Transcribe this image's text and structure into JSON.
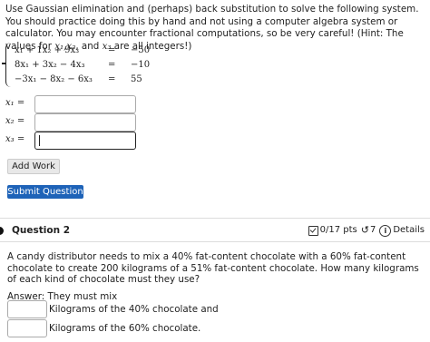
{
  "question1": {
    "instructions_part1": "Use Gaussian elimination and (perhaps) back substitution to solve the following system. You should practice doing this by hand and not using a computer algebra system or calculator. You may encounter fractional computations, so be very careful! (Hint: The values for ",
    "var_x1_x2": "x₁,x₂",
    "instructions_and": ", and ",
    "var_x3": "x₃",
    "instructions_part2": " are all integers!)",
    "equations": [
      {
        "lhs": "x₁ + 1x₂ + 9x₃",
        "rel": "=",
        "rhs": "−50"
      },
      {
        "lhs": "8x₁ + 3x₂ − 4x₃",
        "rel": "=",
        "rhs": "−10"
      },
      {
        "lhs": "−3x₁ − 8x₂ − 6x₃",
        "rel": "=",
        "rhs": "55"
      }
    ],
    "answers": [
      {
        "label": "x₁ =",
        "value": ""
      },
      {
        "label": "x₂ =",
        "value": ""
      },
      {
        "label": "x₃ =",
        "value": ""
      }
    ],
    "add_work_label": "Add Work",
    "submit_label": "Submit Question"
  },
  "question2": {
    "title": "Question 2",
    "points": "0/17 pts",
    "retry_icon": "↺",
    "attempts": "7",
    "details_label": "Details",
    "text": "A candy distributor needs to mix a 40% fat-content chocolate with a 60% fat-content chocolate to create 200 kilograms of a 51% fat-content chocolate. How many kilograms of each kind of chocolate must they use?",
    "answer_label": "Answer: They must mix",
    "mix_rows": [
      {
        "value": "",
        "label": "Kilograms of the 40% chocolate and"
      },
      {
        "value": "",
        "label": "Kilograms of the 60% chocolate."
      }
    ]
  },
  "colors": {
    "submit_bg": "#1e63b8",
    "add_work_bg": "#e8e8e8",
    "divider": "#dcdcdc"
  },
  "icons": {
    "points_icon": "checkbox-icon",
    "retry_icon": "retry-icon",
    "info_icon": "info-icon"
  }
}
